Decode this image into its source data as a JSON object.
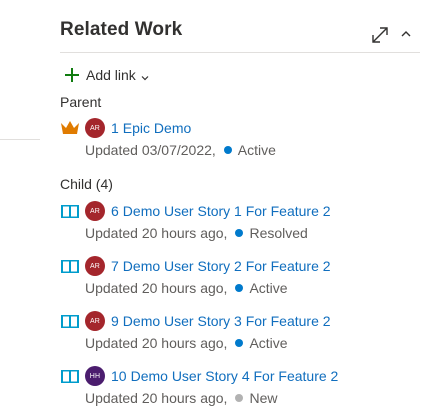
{
  "panel": {
    "title": "Related Work",
    "add_link_label": "Add link",
    "icons": {
      "expand": "expand-diagonal-icon",
      "collapse": "chevron-up-icon",
      "add": "plus-icon",
      "dropdown": "chevron-down-icon"
    }
  },
  "colors": {
    "link": "#106ebe",
    "plus": "#107c10",
    "epic": "#e07b00",
    "story": "#009ccc",
    "active": "#007acc",
    "resolved": "#007acc",
    "new": "#b2b2b2",
    "avatar_ar": "#a4262c",
    "avatar_hh": "#4b1d6e"
  },
  "groups": {
    "parent": {
      "label": "Parent",
      "items": [
        {
          "id": "1",
          "title": "Epic Demo",
          "type_icon": "crown-icon",
          "avatar": "AR",
          "updated": "Updated 03/07/2022,",
          "state": "Active"
        }
      ]
    },
    "child": {
      "label": "Child (4)",
      "items": [
        {
          "id": "6",
          "title": "Demo User Story 1 For Feature 2",
          "type_icon": "book-icon",
          "avatar": "AR",
          "updated": "Updated 20 hours ago,",
          "state": "Resolved"
        },
        {
          "id": "7",
          "title": "Demo User Story 2 For Feature 2",
          "type_icon": "book-icon",
          "avatar": "AR",
          "updated": "Updated 20 hours ago,",
          "state": "Active"
        },
        {
          "id": "9",
          "title": "Demo User Story 3 For Feature 2",
          "type_icon": "book-icon",
          "avatar": "AR",
          "updated": "Updated 20 hours ago,",
          "state": "Active"
        },
        {
          "id": "10",
          "title": "Demo User Story 4 For Feature 2",
          "type_icon": "book-icon",
          "avatar": "HH",
          "updated": "Updated 20 hours ago,",
          "state": "New"
        }
      ]
    }
  }
}
